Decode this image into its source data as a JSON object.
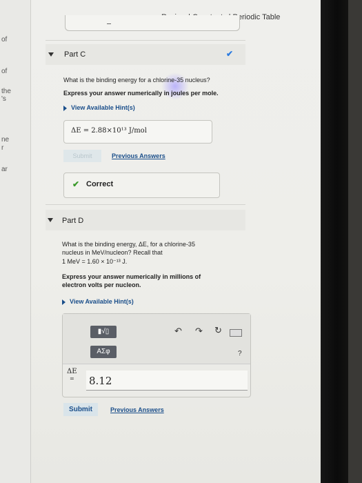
{
  "header": {
    "links": "Review | Constants | Periodic Table"
  },
  "left_fragments": [
    "of",
    "of",
    "the",
    "'s",
    "ne",
    "r",
    "ar"
  ],
  "part_c": {
    "label": "Part C",
    "question": "What is the binding energy for a chlorine-35 nucleus?",
    "instruction": "Express your answer numerically in joules per mole.",
    "hint_link": "View Available Hint(s)",
    "answer": "ΔE = 2.88×10¹³ J/mol",
    "submit_label": "Submit",
    "previous_answers": "Previous Answers",
    "feedback": "Correct"
  },
  "part_d": {
    "label": "Part D",
    "question_line1": "What is the binding energy, ΔE, for a chlorine-35",
    "question_line2": "nucleus in MeV/nucleon? Recall that",
    "question_line3": "1 MeV = 1.60 × 10⁻¹³ J.",
    "instruction_line1": "Express your answer numerically in millions of",
    "instruction_line2": "electron volts per nucleon.",
    "hint_link": "View Available Hint(s)",
    "toolbar_templates": "▮√▯",
    "toolbar_greek": "ΑΣφ",
    "input_label": "ΔE",
    "input_eq": "=",
    "input_value": "8.12",
    "help": "?",
    "submit_label": "Submit",
    "previous_answers": "Previous Answers"
  }
}
